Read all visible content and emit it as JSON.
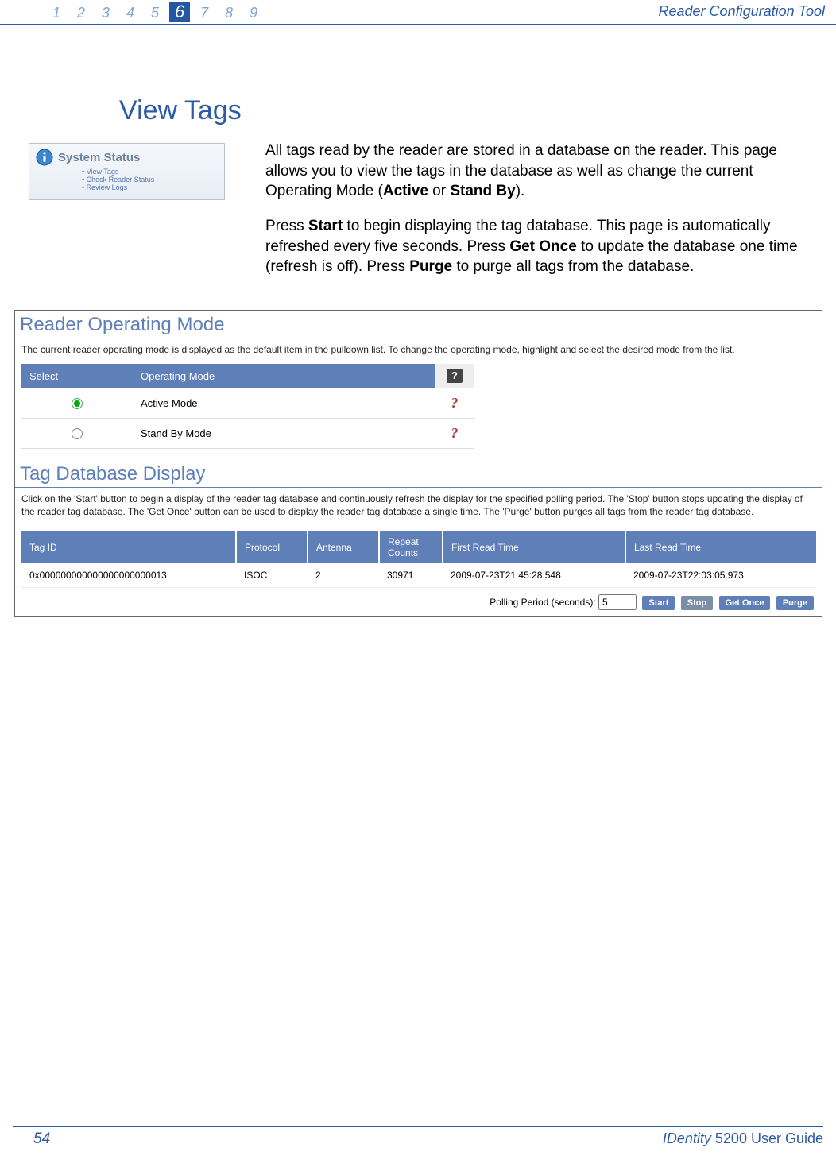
{
  "header": {
    "chapters": [
      "1",
      "2",
      "3",
      "4",
      "5",
      "6",
      "7",
      "8",
      "9"
    ],
    "active_chapter_index": 5,
    "title": "Reader Configuration Tool"
  },
  "section_heading": "View Tags",
  "status_box": {
    "title": "System Status",
    "items": [
      "View Tags",
      "Check Reader Status",
      "Review Logs"
    ]
  },
  "body": {
    "para1_pre": "All tags read by the reader are stored in a database on the reader. This page allows you to view the tags in the database as well as change the current Operating Mode (",
    "active_label": "Active",
    "or_word": " or ",
    "standby_label": "Stand By",
    "para1_post": ").",
    "para2_pre": "Press ",
    "start_label": "Start",
    "para2_mid1": " to begin displaying the tag database. This page is automatically refreshed every five seconds. Press ",
    "getonce_label": "Get Once",
    "para2_mid2": " to update the database one time (refresh is off). Press ",
    "purge_label": "Purge",
    "para2_post": " to purge all tags from the database."
  },
  "panel": {
    "mode_title": "Reader Operating Mode",
    "mode_desc": "The current reader operating mode is displayed as the default item in the pulldown list. To change the operating mode, highlight and select the desired mode from the list.",
    "mode_headers": {
      "select": "Select",
      "mode": "Operating Mode",
      "help": "?"
    },
    "mode_rows": [
      {
        "label": "Active Mode",
        "checked": true
      },
      {
        "label": "Stand By Mode",
        "checked": false
      }
    ],
    "db_title": "Tag Database Display",
    "db_desc": "Click on the 'Start' button to begin a display of the reader tag database and continuously refresh the display for the specified polling period. The 'Stop' button stops updating the display of the reader tag database. The 'Get Once' button can be used to display the reader tag database a single time. The 'Purge' button purges all tags from the reader tag database.",
    "tag_headers": {
      "tag_id": "Tag ID",
      "protocol": "Protocol",
      "antenna": "Antenna",
      "repeat": "Repeat Counts",
      "first": "First Read Time",
      "last": "Last Read Time"
    },
    "tag_rows": [
      {
        "tag_id": "0x000000000000000000000013",
        "protocol": "ISOC",
        "antenna": "2",
        "repeat": "30971",
        "first": "2009-07-23T21:45:28.548",
        "last": "2009-07-23T22:03:05.973"
      }
    ],
    "polling_label": "Polling Period (seconds):",
    "polling_value": "5",
    "buttons": {
      "start": "Start",
      "stop": "Stop",
      "get_once": "Get Once",
      "purge": "Purge"
    }
  },
  "footer": {
    "page_number": "54",
    "guide_prefix_italic": "IDentity",
    "guide_rest": " 5200 User Guide"
  }
}
